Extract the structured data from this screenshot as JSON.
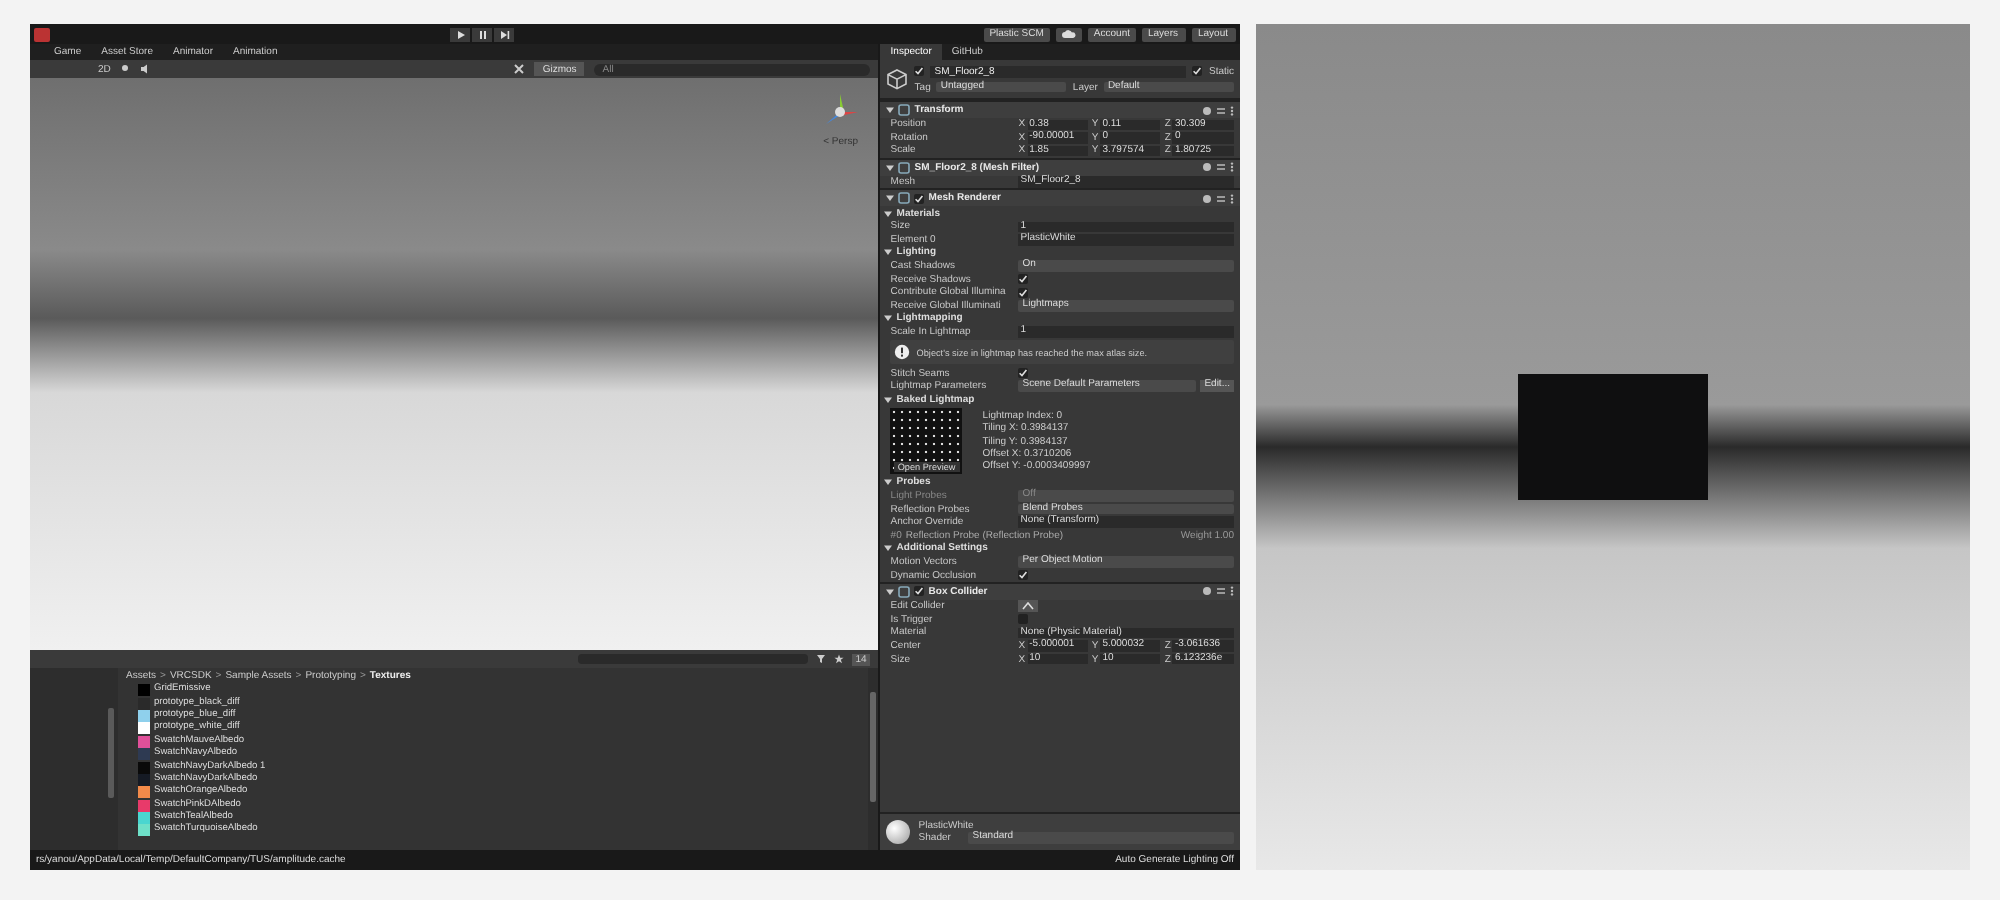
{
  "toolbar": {
    "plastic": "Plastic SCM",
    "account": "Account",
    "layers": "Layers",
    "layout": "Layout"
  },
  "view_tabs": [
    {
      "label": "Game",
      "selected": false
    },
    {
      "label": "Asset Store",
      "selected": false
    },
    {
      "label": "Animator",
      "selected": false
    },
    {
      "label": "Animation",
      "selected": false
    }
  ],
  "scene_toolbar": {
    "mode": "2D",
    "gizmos": "Gizmos",
    "search_placeholder": "All"
  },
  "scene": {
    "projection": "< Persp"
  },
  "project": {
    "hidden_count": "14",
    "separator": ">",
    "breadcrumbs": [
      "Assets",
      "VRCSDK",
      "Sample Assets",
      "Prototyping",
      "Textures"
    ],
    "files": [
      {
        "name": "GridEmissive",
        "color": "#000000"
      },
      {
        "name": "prototype_black_diff",
        "color": "#2a2a2a"
      },
      {
        "name": "prototype_blue_diff",
        "color": "#8fd0ec"
      },
      {
        "name": "prototype_white_diff",
        "color": "#ffffff"
      },
      {
        "name": "SwatchMauveAlbedo",
        "color": "#e0509a"
      },
      {
        "name": "SwatchNavyAlbedo",
        "color": "#2e3a52"
      },
      {
        "name": "SwatchNavyDarkAlbedo 1",
        "color": "#0a0a0a"
      },
      {
        "name": "SwatchNavyDarkAlbedo",
        "color": "#151a24"
      },
      {
        "name": "SwatchOrangeAlbedo",
        "color": "#f28a4a"
      },
      {
        "name": "SwatchPinkDAlbedo",
        "color": "#e83a6a"
      },
      {
        "name": "SwatchTealAlbedo",
        "color": "#4ad6d0"
      },
      {
        "name": "SwatchTurquoiseAlbedo",
        "color": "#6ee0c8"
      }
    ]
  },
  "inspector": {
    "tabs": [
      {
        "label": "Inspector",
        "selected": true
      },
      {
        "label": "GitHub",
        "selected": false
      }
    ],
    "object": {
      "name": "SM_Floor2_8",
      "active": true,
      "static_label": "Static",
      "static": true,
      "tag_label": "Tag",
      "tag": "Untagged",
      "layer_label": "Layer",
      "layer": "Default"
    },
    "rows": [
      {
        "kind": "component",
        "title": "Transform"
      },
      {
        "kind": "vec3",
        "label": "Position",
        "values": [
          {
            "axis": "X",
            "value": "0.38"
          },
          {
            "axis": "Y",
            "value": "0.11"
          },
          {
            "axis": "Z",
            "value": "30.309"
          }
        ]
      },
      {
        "kind": "vec3",
        "label": "Rotation",
        "values": [
          {
            "axis": "X",
            "value": "-90.00001"
          },
          {
            "axis": "Y",
            "value": "0"
          },
          {
            "axis": "Z",
            "value": "0"
          }
        ]
      },
      {
        "kind": "vec3",
        "label": "Scale",
        "values": [
          {
            "axis": "X",
            "value": "1.85"
          },
          {
            "axis": "Y",
            "value": "3.797574"
          },
          {
            "axis": "Z",
            "value": "1.80725"
          }
        ]
      },
      {
        "kind": "component",
        "title": "SM_Floor2_8 (Mesh Filter)"
      },
      {
        "kind": "object",
        "label": "Mesh",
        "value": "SM_Floor2_8"
      },
      {
        "kind": "component",
        "title": "Mesh Renderer",
        "enabled": true
      },
      {
        "kind": "section",
        "label": "Materials"
      },
      {
        "kind": "field",
        "label": "Size",
        "value": "1"
      },
      {
        "kind": "object",
        "label": "Element 0",
        "value": "PlasticWhite"
      },
      {
        "kind": "section",
        "label": "Lighting"
      },
      {
        "kind": "dropdown",
        "label": "Cast Shadows",
        "value": "On",
        "disabled": false
      },
      {
        "kind": "checkbox",
        "label": "Receive Shadows",
        "checked": true
      },
      {
        "kind": "checkbox",
        "label": "Contribute Global Illumina",
        "checked": true
      },
      {
        "kind": "dropdown",
        "label": "Receive Global Illuminati",
        "value": "Lightmaps",
        "disabled": false
      },
      {
        "kind": "section",
        "label": "Lightmapping"
      },
      {
        "kind": "field",
        "label": "Scale In Lightmap",
        "value": "1"
      },
      {
        "kind": "info",
        "text": "Object's size in lightmap has reached the max atlas size."
      },
      {
        "kind": "checkbox",
        "label": "Stitch Seams",
        "checked": true
      },
      {
        "kind": "dropdown",
        "label": "Lightmap Parameters",
        "value": "Scene Default Parameters",
        "button": "Edit...",
        "disabled": false
      },
      {
        "kind": "lightmap",
        "label": "Baked Lightmap",
        "preview": "Open Preview",
        "lines": [
          "Lightmap Index: 0",
          "Tiling X: 0.3984137",
          "Tiling Y: 0.3984137",
          "Offset X: 0.3710206",
          "Offset Y: -0.0003409997"
        ]
      },
      {
        "kind": "section",
        "label": "Probes"
      },
      {
        "kind": "dropdown",
        "label": "Light Probes",
        "value": "Off",
        "disabled": true
      },
      {
        "kind": "dropdown",
        "label": "Reflection Probes",
        "value": "Blend Probes",
        "disabled": false
      },
      {
        "kind": "object",
        "label": "Anchor Override",
        "value": "None (Transform)"
      },
      {
        "kind": "probe",
        "index": "#0",
        "value": "Reflection Probe (Reflection Probe)",
        "weight": "Weight 1.00"
      },
      {
        "kind": "section",
        "label": "Additional Settings"
      },
      {
        "kind": "dropdown",
        "label": "Motion Vectors",
        "value": "Per Object Motion",
        "disabled": false
      },
      {
        "kind": "checkbox",
        "label": "Dynamic Occlusion",
        "checked": true
      },
      {
        "kind": "component",
        "title": "Box Collider",
        "enabled": true
      },
      {
        "kind": "edit",
        "label": "Edit Collider"
      },
      {
        "kind": "checkbox",
        "label": "Is Trigger",
        "checked": false
      },
      {
        "kind": "object",
        "label": "Material",
        "value": "None (Physic Material)"
      },
      {
        "kind": "vec3",
        "label": "Center",
        "values": [
          {
            "axis": "X",
            "value": "-5.000001"
          },
          {
            "axis": "Y",
            "value": "5.000032"
          },
          {
            "axis": "Z",
            "value": "-3.061636"
          }
        ]
      },
      {
        "kind": "vec3",
        "label": "Size",
        "values": [
          {
            "axis": "X",
            "value": "10"
          },
          {
            "axis": "Y",
            "value": "10"
          },
          {
            "axis": "Z",
            "value": "6.123236e"
          }
        ]
      }
    ],
    "material": {
      "name": "PlasticWhite",
      "shader_label": "Shader",
      "shader": "Standard"
    }
  },
  "status_bar": {
    "path": "rs/yanou/AppData/Local/Temp/DefaultCompany/TUS/amplitude.cache",
    "lighting": "Auto Generate Lighting Off"
  }
}
